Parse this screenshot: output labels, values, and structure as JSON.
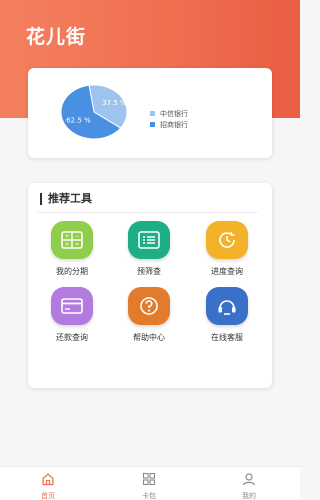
{
  "app": {
    "title": "花儿街"
  },
  "chart_data": {
    "type": "pie",
    "categories": [
      "中信银行",
      "招商银行"
    ],
    "values": [
      37.5,
      62.5
    ],
    "labels": [
      "37.5 %",
      "62.5 %"
    ],
    "colors": [
      "#9dc3ef",
      "#4a90e2"
    ],
    "title": "",
    "legend": "right"
  },
  "tools": {
    "title": "推荐工具",
    "items": [
      {
        "label": "我的分期",
        "icon": "calculator-icon",
        "color": "#8fce4a"
      },
      {
        "label": "预筛查",
        "icon": "list-icon",
        "color": "#1dae86"
      },
      {
        "label": "进度查询",
        "icon": "clock-icon",
        "color": "#f4b22a"
      },
      {
        "label": "还款查询",
        "icon": "credit-card-icon",
        "color": "#b17be0"
      },
      {
        "label": "帮助中心",
        "icon": "question-icon",
        "color": "#e27b2b"
      },
      {
        "label": "在线客服",
        "icon": "headset-icon",
        "color": "#3a70c8"
      }
    ]
  },
  "nav": {
    "items": [
      {
        "label": "首页",
        "icon": "home-icon",
        "active": true
      },
      {
        "label": "卡包",
        "icon": "grid-icon",
        "active": false
      },
      {
        "label": "我的",
        "icon": "user-icon",
        "active": false
      }
    ],
    "active_color": "#ef7050",
    "inactive_color": "#8a8a8a"
  }
}
